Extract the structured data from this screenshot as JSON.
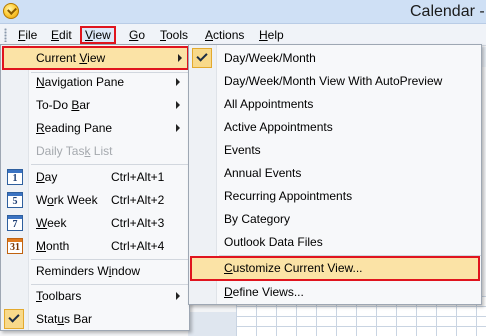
{
  "window": {
    "title": "Calendar -"
  },
  "menubar": {
    "items": [
      {
        "label_pre": "",
        "label_u": "F",
        "label_post": "ile"
      },
      {
        "label_pre": "",
        "label_u": "E",
        "label_post": "dit"
      },
      {
        "label_pre": "",
        "label_u": "V",
        "label_post": "iew"
      },
      {
        "label_pre": "",
        "label_u": "G",
        "label_post": "o"
      },
      {
        "label_pre": "",
        "label_u": "T",
        "label_post": "ools"
      },
      {
        "label_pre": "",
        "label_u": "A",
        "label_post": "ctions"
      },
      {
        "label_pre": "",
        "label_u": "H",
        "label_post": "elp"
      }
    ]
  },
  "view_menu": {
    "current_view": {
      "pre": "Current ",
      "u": "V",
      "post": "iew"
    },
    "navigation_pane": {
      "pre": "",
      "u": "N",
      "post": "avigation Pane"
    },
    "todo_bar": {
      "pre": "To-Do ",
      "u": "B",
      "post": "ar"
    },
    "reading_pane": {
      "pre": "",
      "u": "R",
      "post": "eading Pane"
    },
    "daily_task_list": {
      "pre": "Daily Tas",
      "u": "k",
      "post": " List"
    },
    "day": {
      "pre": "",
      "u": "D",
      "post": "ay",
      "shortcut": "Ctrl+Alt+1",
      "icon_text": "1"
    },
    "work_week": {
      "pre": "W",
      "u": "o",
      "post": "rk Week",
      "shortcut": "Ctrl+Alt+2",
      "icon_text": "5"
    },
    "week": {
      "pre": "",
      "u": "W",
      "post": "eek",
      "shortcut": "Ctrl+Alt+3",
      "icon_text": "7"
    },
    "month": {
      "pre": "",
      "u": "M",
      "post": "onth",
      "shortcut": "Ctrl+Alt+4",
      "icon_text": "31"
    },
    "reminders_window": {
      "pre": "Reminders W",
      "u": "i",
      "post": "ndow"
    },
    "toolbars": {
      "pre": "",
      "u": "T",
      "post": "oolbars"
    },
    "status_bar": {
      "pre": "Stat",
      "u": "u",
      "post": "s Bar"
    }
  },
  "current_view_menu": {
    "items": [
      "Day/Week/Month",
      "Day/Week/Month View With AutoPreview",
      "All Appointments",
      "Active Appointments",
      "Events",
      "Annual Events",
      "Recurring Appointments",
      "By Category",
      "Outlook Data Files"
    ],
    "customize": {
      "pre": "",
      "u": "C",
      "post": "ustomize Current View..."
    },
    "define": {
      "pre": "",
      "u": "D",
      "post": "efine Views..."
    }
  },
  "colors": {
    "highlight_border": "#e0141e",
    "highlight_fill": "#fbe3a6",
    "check_fill": "#f8d98a"
  },
  "icons": {
    "app": "outlook-app-icon",
    "day": "calendar-day-icon",
    "work_week": "calendar-work-week-icon",
    "week": "calendar-week-icon",
    "month": "calendar-month-icon",
    "check": "check-icon",
    "submenu": "chevron-right-icon"
  }
}
